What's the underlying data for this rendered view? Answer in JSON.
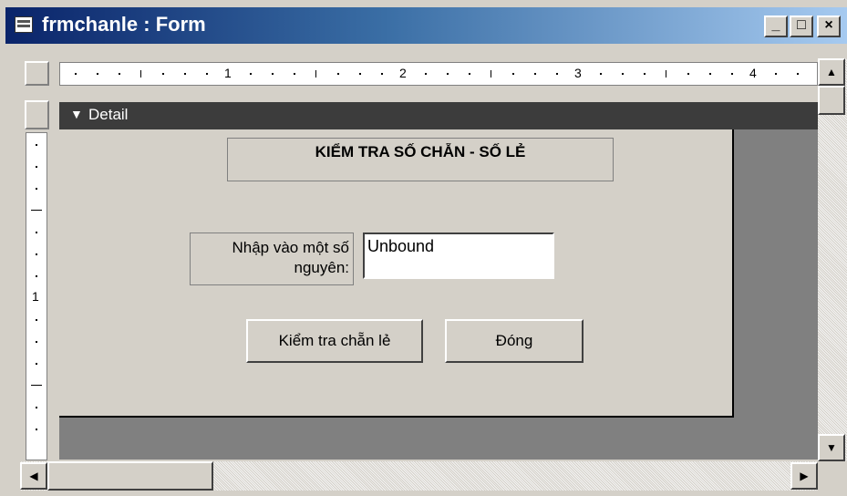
{
  "window": {
    "title": "frmchanle : Form",
    "minimize_glyph": "_",
    "maximize_glyph": "□",
    "close_glyph": "×"
  },
  "ruler": {
    "h_numbers": [
      "1",
      "2",
      "3",
      "4"
    ],
    "v_numbers": [
      "1"
    ]
  },
  "section": {
    "label": "Detail",
    "arrow_glyph": "▼"
  },
  "form": {
    "title_label": "KIỂM TRA SỐ CHẴN - SỐ LẺ",
    "input_label": "Nhập vào một số nguyên:",
    "input_value": "Unbound",
    "check_button": "Kiểm tra chẵn lẻ",
    "close_button": "Đóng"
  },
  "scroll": {
    "up_glyph": "▲",
    "down_glyph": "▼",
    "left_glyph": "◀",
    "right_glyph": "▶"
  },
  "colors": {
    "titlebar_start": "#0a246a",
    "titlebar_end": "#a6caf0",
    "detail_bar": "#3c3c3c",
    "form_bg": "#d4d0c8",
    "design_bg": "#808080"
  }
}
